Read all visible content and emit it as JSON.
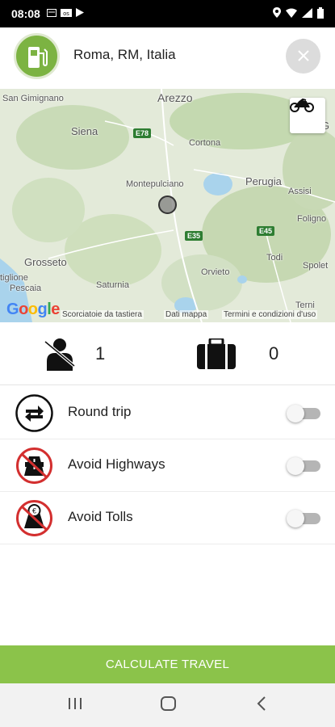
{
  "status_bar": {
    "time": "08:08",
    "left_icons": [
      "message-icon",
      "outlook-icon",
      "play-store-icon"
    ],
    "right_icons": [
      "location-icon",
      "wifi-icon",
      "signal-icon",
      "battery-icon"
    ]
  },
  "header": {
    "location": "Roma, RM, Italia",
    "logo_icon": "fuel-pump-icon",
    "clear_icon": "close-icon"
  },
  "map": {
    "labels": {
      "arezzo": "Arezzo",
      "san_gimignano": "San Gimignano",
      "siena": "Siena",
      "cortona": "Cortona",
      "montepulciano": "Montepulciano",
      "perugia": "Perugia",
      "assisi": "Assisi",
      "foligno": "Foligno",
      "grosseto": "Grosseto",
      "todi": "Todi",
      "spoleto": "Spolet",
      "orvieto": "Orvieto",
      "saturnia": "Saturnia",
      "tiglione": "tiglione",
      "pescaia": "Pescaia",
      "terni": "Terni",
      "g": "G"
    },
    "roads": {
      "e78": "E78",
      "e35": "E35",
      "e45": "E45"
    },
    "google": "Google",
    "footer": {
      "shortcuts": "Scorciatoie da tastiera",
      "map_data": "Dati mappa",
      "terms": "Termini e condizioni d'uso"
    },
    "vehicle_icon": "motorcycle-icon"
  },
  "counts": {
    "passengers": "1",
    "luggage": "0"
  },
  "options": [
    {
      "label": "Round trip",
      "icon": "round-trip-icon",
      "on": false
    },
    {
      "label": "Avoid Highways",
      "icon": "no-highway-icon",
      "on": false
    },
    {
      "label": "Avoid Tolls",
      "icon": "no-toll-icon",
      "on": false
    }
  ],
  "calculate_button": "CALCULATE TRAVEL",
  "colors": {
    "accent": "#8bc34a",
    "logo": "#7cb342",
    "forbidden": "#d32f2f"
  }
}
